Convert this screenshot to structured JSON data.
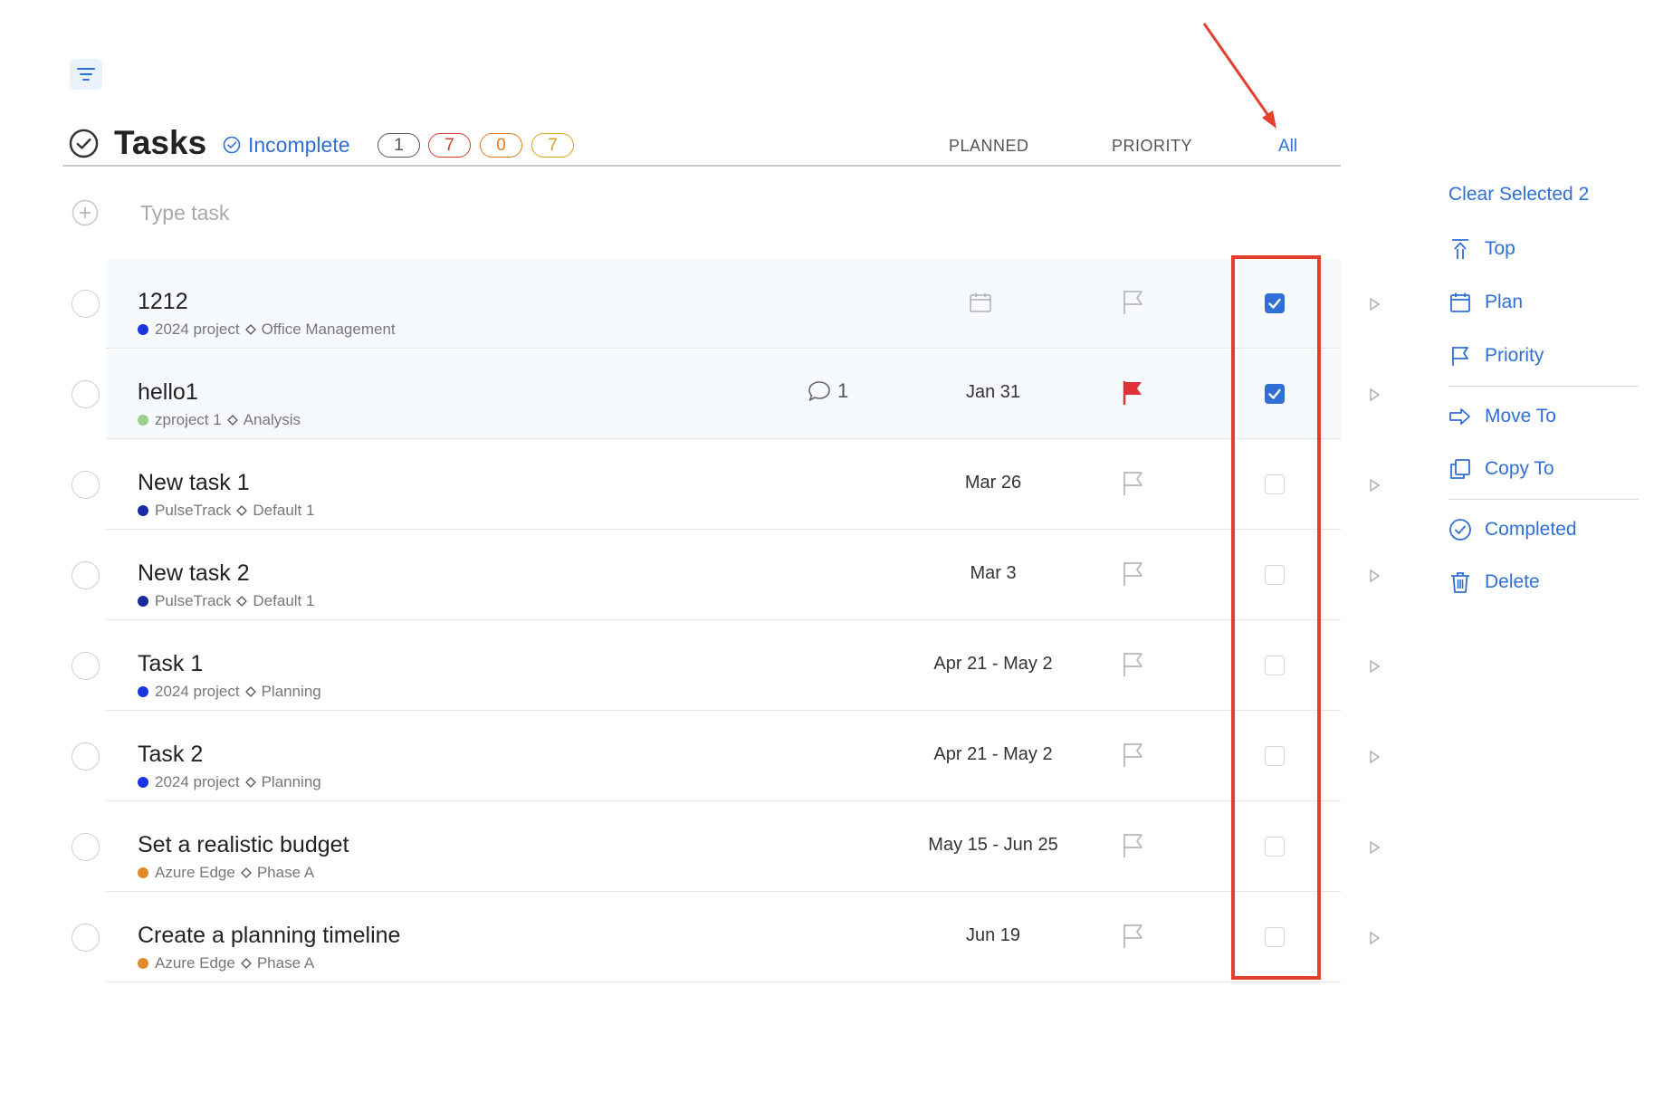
{
  "toolbar": {
    "filter_icon": "filter-icon"
  },
  "header": {
    "title": "Tasks",
    "filter_label": "Incomplete",
    "counts": [
      {
        "value": "1",
        "color": "#555555"
      },
      {
        "value": "7",
        "color": "#d63a2f"
      },
      {
        "value": "0",
        "color": "#e07b1a"
      },
      {
        "value": "7",
        "color": "#d9a516"
      }
    ],
    "columns": {
      "planned": "PLANNED",
      "priority": "PRIORITY",
      "all": "All"
    }
  },
  "add_task": {
    "placeholder": "Type task"
  },
  "tasks": [
    {
      "title": "1212",
      "project": "2024 project",
      "project_color": "#1a34e0",
      "section": "Office Management",
      "date": "",
      "calendar_icon": true,
      "comments": "",
      "priority_flag": false,
      "selected": true
    },
    {
      "title": "hello1",
      "project": "zproject 1",
      "project_color": "#9fcf8f",
      "section": "Analysis",
      "date": "Jan 31",
      "calendar_icon": false,
      "comments": "1",
      "priority_flag": true,
      "selected": true
    },
    {
      "title": "New task 1",
      "project": "PulseTrack",
      "project_color": "#1a2aa0",
      "section": "Default 1",
      "date": "Mar 26",
      "calendar_icon": false,
      "comments": "",
      "priority_flag": false,
      "selected": false
    },
    {
      "title": "New task 2",
      "project": "PulseTrack",
      "project_color": "#1a2aa0",
      "section": "Default 1",
      "date": "Mar 3",
      "calendar_icon": false,
      "comments": "",
      "priority_flag": false,
      "selected": false
    },
    {
      "title": "Task 1",
      "project": "2024 project",
      "project_color": "#1a34e0",
      "section": "Planning",
      "date": "Apr 21 - May 2",
      "calendar_icon": false,
      "comments": "",
      "priority_flag": false,
      "selected": false
    },
    {
      "title": "Task 2",
      "project": "2024 project",
      "project_color": "#1a34e0",
      "section": "Planning",
      "date": "Apr 21 - May 2",
      "calendar_icon": false,
      "comments": "",
      "priority_flag": false,
      "selected": false
    },
    {
      "title": "Set a realistic budget",
      "project": "Azure Edge",
      "project_color": "#e08a2a",
      "section": "Phase A",
      "date": "May 15 - Jun 25",
      "calendar_icon": false,
      "comments": "",
      "priority_flag": false,
      "selected": false
    },
    {
      "title": "Create a planning timeline",
      "project": "Azure Edge",
      "project_color": "#e08a2a",
      "section": "Phase A",
      "date": "Jun 19",
      "calendar_icon": false,
      "comments": "",
      "priority_flag": false,
      "selected": false
    }
  ],
  "side_panel": {
    "clear_selected": "Clear Selected 2",
    "top": "Top",
    "plan": "Plan",
    "priority": "Priority",
    "move_to": "Move To",
    "copy_to": "Copy To",
    "completed": "Completed",
    "delete": "Delete"
  },
  "colors": {
    "accent": "#2f6fd6",
    "highlight": "#e4402f",
    "flag_red": "#e0303a"
  }
}
